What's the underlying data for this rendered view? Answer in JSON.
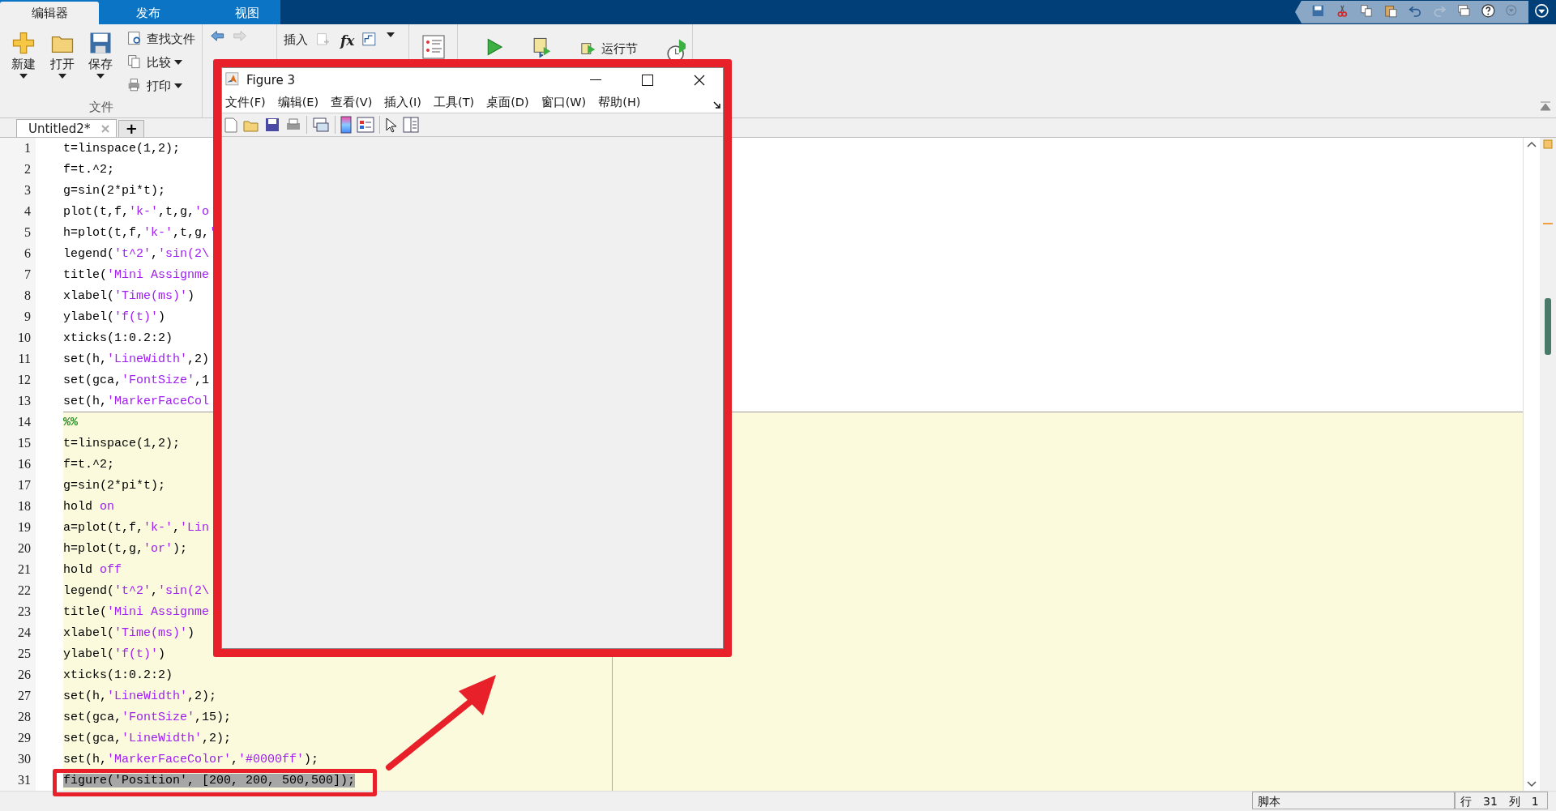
{
  "tabs": [
    {
      "label": "编辑器",
      "selected": true
    },
    {
      "label": "发布",
      "selected": false
    },
    {
      "label": "视图",
      "selected": false
    }
  ],
  "toolstrip": {
    "file_section": {
      "label": "文件",
      "large_buttons": [
        {
          "kind": "new",
          "label": "新建"
        },
        {
          "kind": "open",
          "label": "打开"
        },
        {
          "kind": "save",
          "label": "保存"
        }
      ],
      "small_buttons": [
        {
          "kind": "find",
          "label": "查找文件",
          "dropdown": false
        },
        {
          "kind": "compare",
          "label": "比较",
          "dropdown": true
        },
        {
          "kind": "print",
          "label": "打印",
          "dropdown": true
        }
      ]
    },
    "insert_label": "插入",
    "fx_label": "fx",
    "run_section_label": "运行节"
  },
  "document_tabs": [
    {
      "label": "Untitled2*",
      "selected": true
    }
  ],
  "new_tab_label": "+",
  "editor": {
    "lines": [
      {
        "number": "1",
        "active_cell": false,
        "selected": false,
        "tokens": [
          {
            "kind": "code",
            "text": "t=linspace(1,2);"
          }
        ]
      },
      {
        "number": "2",
        "active_cell": false,
        "selected": false,
        "tokens": [
          {
            "kind": "code",
            "text": "f=t.^2;"
          }
        ]
      },
      {
        "number": "3",
        "active_cell": false,
        "selected": false,
        "tokens": [
          {
            "kind": "code",
            "text": "g=sin(2*pi*t);"
          }
        ]
      },
      {
        "number": "4",
        "active_cell": false,
        "selected": false,
        "tokens": [
          {
            "kind": "code",
            "text": "plot(t,f,"
          },
          {
            "kind": "string",
            "text": "'k-'"
          },
          {
            "kind": "code",
            "text": ",t,g,"
          },
          {
            "kind": "string",
            "text": "'o"
          }
        ]
      },
      {
        "number": "5",
        "active_cell": false,
        "selected": false,
        "tokens": [
          {
            "kind": "code",
            "text": "h=plot(t,f,"
          },
          {
            "kind": "string",
            "text": "'k-'"
          },
          {
            "kind": "code",
            "text": ",t,g,"
          },
          {
            "kind": "string",
            "text": "'"
          }
        ]
      },
      {
        "number": "6",
        "active_cell": false,
        "selected": false,
        "tokens": [
          {
            "kind": "code",
            "text": "legend("
          },
          {
            "kind": "string",
            "text": "'t^2'"
          },
          {
            "kind": "code",
            "text": ","
          },
          {
            "kind": "string",
            "text": "'sin(2\\"
          }
        ]
      },
      {
        "number": "7",
        "active_cell": false,
        "selected": false,
        "tokens": [
          {
            "kind": "code",
            "text": "title("
          },
          {
            "kind": "string",
            "text": "'Mini Assignme"
          }
        ]
      },
      {
        "number": "8",
        "active_cell": false,
        "selected": false,
        "tokens": [
          {
            "kind": "code",
            "text": "xlabel("
          },
          {
            "kind": "string",
            "text": "'Time(ms)'"
          },
          {
            "kind": "code",
            "text": ")"
          }
        ]
      },
      {
        "number": "9",
        "active_cell": false,
        "selected": false,
        "tokens": [
          {
            "kind": "code",
            "text": "ylabel("
          },
          {
            "kind": "string",
            "text": "'f(t)'"
          },
          {
            "kind": "code",
            "text": ")"
          }
        ]
      },
      {
        "number": "10",
        "active_cell": false,
        "selected": false,
        "tokens": [
          {
            "kind": "code",
            "text": "xticks(1:0.2:2)"
          }
        ]
      },
      {
        "number": "11",
        "active_cell": false,
        "selected": false,
        "tokens": [
          {
            "kind": "code",
            "text": "set(h,"
          },
          {
            "kind": "string",
            "text": "'LineWidth'"
          },
          {
            "kind": "code",
            "text": ",2)"
          }
        ]
      },
      {
        "number": "12",
        "active_cell": false,
        "selected": false,
        "tokens": [
          {
            "kind": "code",
            "text": "set(gca,"
          },
          {
            "kind": "string",
            "text": "'FontSize'"
          },
          {
            "kind": "code",
            "text": ",1"
          }
        ]
      },
      {
        "number": "13",
        "active_cell": false,
        "selected": false,
        "tokens": [
          {
            "kind": "code",
            "text": "set(h,"
          },
          {
            "kind": "string",
            "text": "'MarkerFaceCol"
          }
        ]
      },
      {
        "number": "14",
        "active_cell": true,
        "selected": false,
        "tokens": [
          {
            "kind": "comment",
            "text": "%%"
          }
        ]
      },
      {
        "number": "15",
        "active_cell": true,
        "selected": false,
        "tokens": [
          {
            "kind": "code",
            "text": "t=linspace(1,2);"
          }
        ]
      },
      {
        "number": "16",
        "active_cell": true,
        "selected": false,
        "tokens": [
          {
            "kind": "code",
            "text": "f=t.^2;"
          }
        ]
      },
      {
        "number": "17",
        "active_cell": true,
        "selected": false,
        "tokens": [
          {
            "kind": "code",
            "text": "g=sin(2*pi*t);"
          }
        ]
      },
      {
        "number": "18",
        "active_cell": true,
        "selected": false,
        "tokens": [
          {
            "kind": "code",
            "text": "hold "
          },
          {
            "kind": "string",
            "text": "on"
          }
        ]
      },
      {
        "number": "19",
        "active_cell": true,
        "selected": false,
        "tokens": [
          {
            "kind": "code",
            "text": "a=plot(t,f,"
          },
          {
            "kind": "string",
            "text": "'k-'"
          },
          {
            "kind": "code",
            "text": ","
          },
          {
            "kind": "string",
            "text": "'Lin"
          }
        ]
      },
      {
        "number": "20",
        "active_cell": true,
        "selected": false,
        "tokens": [
          {
            "kind": "code",
            "text": "h=plot(t,g,"
          },
          {
            "kind": "string",
            "text": "'or'"
          },
          {
            "kind": "code",
            "text": ");"
          }
        ]
      },
      {
        "number": "21",
        "active_cell": true,
        "selected": false,
        "tokens": [
          {
            "kind": "code",
            "text": "hold "
          },
          {
            "kind": "string",
            "text": "off"
          }
        ]
      },
      {
        "number": "22",
        "active_cell": true,
        "selected": false,
        "tokens": [
          {
            "kind": "code",
            "text": "legend("
          },
          {
            "kind": "string",
            "text": "'t^2'"
          },
          {
            "kind": "code",
            "text": ","
          },
          {
            "kind": "string",
            "text": "'sin(2\\"
          }
        ]
      },
      {
        "number": "23",
        "active_cell": true,
        "selected": false,
        "tokens": [
          {
            "kind": "code",
            "text": "title("
          },
          {
            "kind": "string",
            "text": "'Mini Assignme"
          }
        ]
      },
      {
        "number": "24",
        "active_cell": true,
        "selected": false,
        "tokens": [
          {
            "kind": "code",
            "text": "xlabel("
          },
          {
            "kind": "string",
            "text": "'Time(ms)'"
          },
          {
            "kind": "code",
            "text": ")"
          }
        ]
      },
      {
        "number": "25",
        "active_cell": true,
        "selected": false,
        "tokens": [
          {
            "kind": "code",
            "text": "ylabel("
          },
          {
            "kind": "string",
            "text": "'f(t)'"
          },
          {
            "kind": "code",
            "text": ")"
          }
        ]
      },
      {
        "number": "26",
        "active_cell": true,
        "selected": false,
        "tokens": [
          {
            "kind": "code",
            "text": "xticks(1:0.2:2)"
          }
        ]
      },
      {
        "number": "27",
        "active_cell": true,
        "selected": false,
        "tokens": [
          {
            "kind": "code",
            "text": "set(h,"
          },
          {
            "kind": "string",
            "text": "'LineWidth'"
          },
          {
            "kind": "code",
            "text": ",2);"
          }
        ]
      },
      {
        "number": "28",
        "active_cell": true,
        "selected": false,
        "tokens": [
          {
            "kind": "code",
            "text": "set(gca,"
          },
          {
            "kind": "string",
            "text": "'FontSize'"
          },
          {
            "kind": "code",
            "text": ",15);"
          }
        ]
      },
      {
        "number": "29",
        "active_cell": true,
        "selected": false,
        "tokens": [
          {
            "kind": "code",
            "text": "set(gca,"
          },
          {
            "kind": "string",
            "text": "'LineWidth'"
          },
          {
            "kind": "code",
            "text": ",2);"
          }
        ]
      },
      {
        "number": "30",
        "active_cell": true,
        "selected": false,
        "tokens": [
          {
            "kind": "code",
            "text": "set(h,"
          },
          {
            "kind": "string",
            "text": "'MarkerFaceColor'"
          },
          {
            "kind": "code",
            "text": ","
          },
          {
            "kind": "string",
            "text": "'#0000ff'"
          },
          {
            "kind": "code",
            "text": ");"
          }
        ]
      },
      {
        "number": "31",
        "active_cell": true,
        "selected": true,
        "tokens": [
          {
            "kind": "code",
            "text": "figure('Position', [200, 200, 500,500]);"
          }
        ]
      }
    ]
  },
  "figure_window": {
    "title": "Figure 3",
    "menu": [
      "文件(F)",
      "编辑(E)",
      "查看(V)",
      "插入(I)",
      "工具(T)",
      "桌面(D)",
      "窗口(W)",
      "帮助(H)"
    ]
  },
  "status_bar": {
    "mode": "脚本",
    "row_label": "行",
    "row": "31",
    "col_label": "列",
    "col": "1"
  }
}
